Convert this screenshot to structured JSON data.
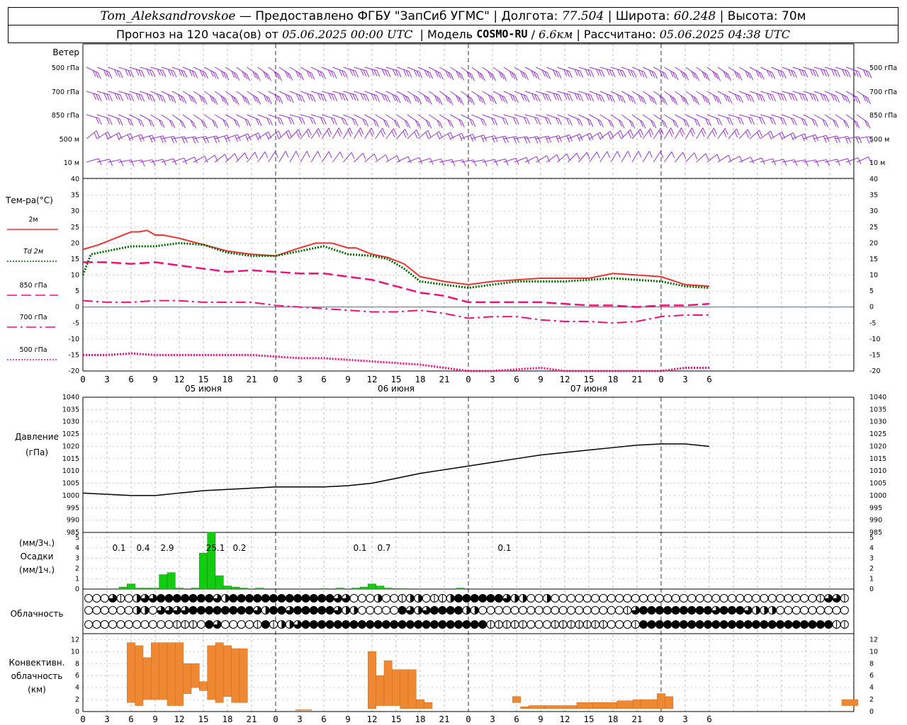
{
  "header": {
    "station": "Tom_Aleksandrovskoe",
    "provider": "Предоставлено ФГБУ \"ЗапСиб УГМС\"",
    "lon_label": "Долгота:",
    "lon": "77.504",
    "lat_label": "Широта:",
    "lat": "60.248",
    "alt_label": "Высота:",
    "alt": "70м",
    "forecast_prefix": "Прогноз на 120 часа(ов) от",
    "forecast_start": "05.06.2025 00:00 UTC",
    "model_label": "Модель",
    "model": "COSMO-RU",
    "resolution": "6.6км",
    "calc_label": "Рассчитано:",
    "calc_time": "05.06.2025 04:38 UTC"
  },
  "x_axis": {
    "hour_ticks": [
      "0",
      "3",
      "6",
      "9",
      "12",
      "15",
      "18",
      "21",
      "0",
      "3",
      "6",
      "9",
      "12",
      "15",
      "18",
      "21",
      "0",
      "3",
      "6",
      "9",
      "12",
      "15",
      "18",
      "21",
      "0",
      "3",
      "6"
    ],
    "dates": [
      "05 июня",
      "06 июня",
      "07 июня"
    ]
  },
  "wind_panel": {
    "title": "Ветер",
    "levels": [
      "500 гПа",
      "700 гПа",
      "850 гПа",
      "500 м",
      "10  м"
    ],
    "color": "#9933cc"
  },
  "temperature_panel": {
    "title": "Тем-ра(°С)",
    "legend": [
      {
        "label": "2м",
        "color": "#ee3333",
        "dash": "solid"
      },
      {
        "label": "Td  2м",
        "color": "#006600",
        "dash": "dotted"
      },
      {
        "label": "850 гПа",
        "color": "#ee1177",
        "dash": "long-dash"
      },
      {
        "label": "700 гПа",
        "color": "#ee1177",
        "dash": "dash-dot"
      },
      {
        "label": "500 гПа",
        "color": "#ee1177",
        "dash": "dotted"
      }
    ],
    "y_ticks": [
      "40",
      "35",
      "30",
      "25",
      "20",
      "15",
      "10",
      "5",
      "0",
      "-5",
      "-10",
      "-15",
      "-20"
    ]
  },
  "pressure_panel": {
    "title": "Давление",
    "unit": "(гПа)",
    "y_ticks": [
      "1040",
      "1035",
      "1030",
      "1025",
      "1020",
      "1015",
      "1010",
      "1005",
      "1000",
      "995",
      "990",
      "985"
    ]
  },
  "precip_panel": {
    "unit1": "(мм/3ч.)",
    "title": "Осадки",
    "unit2": "(мм/1ч.)",
    "y_ticks": [
      "5",
      "4",
      "3",
      "2",
      "1",
      "0"
    ],
    "totals": [
      {
        "hour": 6,
        "text": "0.1"
      },
      {
        "hour": 9,
        "text": "0.4"
      },
      {
        "hour": 12,
        "text": "2.9"
      },
      {
        "hour": 18,
        "text": "25.1"
      },
      {
        "hour": 21,
        "text": "0.2"
      },
      {
        "hour": 36,
        "text": "0.1"
      },
      {
        "hour": 39,
        "text": "0.7"
      },
      {
        "hour": 54,
        "text": "0.1"
      }
    ],
    "color": "#11cc11"
  },
  "cloud_panel": {
    "title": "Облачность"
  },
  "convective_panel": {
    "title_1": "Конвективн.",
    "title_2": "облачность",
    "unit": "(км)",
    "y_ticks": [
      "12",
      "10",
      "8",
      "6",
      "4",
      "2",
      "0"
    ],
    "color": "#ee8833"
  },
  "chart_data": [
    {
      "type": "line",
      "title": "Тем-ра(°С)",
      "x_unit": "hours from 05.06.2025 00:00 UTC",
      "ylim": [
        -20,
        40
      ],
      "series": [
        {
          "name": "2м",
          "x": [
            0,
            2,
            4,
            6,
            7,
            8,
            9,
            10,
            12,
            15,
            18,
            21,
            24,
            27,
            29,
            31,
            33,
            34,
            36,
            38,
            40,
            42,
            45,
            48,
            51,
            54,
            57,
            60,
            63,
            66,
            69,
            72,
            75,
            78
          ],
          "values": [
            18,
            19.5,
            21.5,
            23.5,
            23.5,
            24,
            22.5,
            22.5,
            21.5,
            19.5,
            17.5,
            16.5,
            16,
            18.5,
            20,
            20,
            18.5,
            18.5,
            16.5,
            15.5,
            13.5,
            9.5,
            8,
            7,
            8,
            8.5,
            9,
            9,
            9,
            10.5,
            10,
            9.5,
            7,
            6.5
          ]
        },
        {
          "name": "Td  2м",
          "x": [
            0,
            1,
            3,
            6,
            9,
            12,
            15,
            18,
            21,
            24,
            27,
            30,
            33,
            36,
            38,
            40,
            42,
            45,
            48,
            51,
            54,
            57,
            60,
            63,
            66,
            69,
            72,
            75,
            78
          ],
          "values": [
            10,
            16.5,
            17.5,
            19,
            19,
            20,
            19.5,
            17,
            16,
            16,
            17.5,
            19,
            16.5,
            16,
            15,
            12,
            8,
            7,
            6,
            7,
            8,
            8,
            8,
            8.5,
            9,
            8.5,
            8,
            6.5,
            6
          ]
        },
        {
          "name": "850 гПа",
          "x": [
            0,
            3,
            6,
            9,
            12,
            15,
            18,
            21,
            24,
            27,
            30,
            33,
            36,
            39,
            42,
            45,
            48,
            51,
            54,
            57,
            60,
            63,
            66,
            69,
            72,
            75,
            78
          ],
          "values": [
            14,
            14,
            13.5,
            14,
            13,
            12,
            11,
            11.5,
            11,
            10.5,
            10.5,
            9.5,
            8.5,
            6.5,
            4.5,
            3.5,
            1.5,
            1.5,
            1.5,
            1.5,
            1,
            0.5,
            0.5,
            0,
            0.5,
            0.5,
            1
          ]
        },
        {
          "name": "700 гПа",
          "x": [
            0,
            3,
            6,
            9,
            12,
            15,
            18,
            21,
            24,
            27,
            30,
            33,
            36,
            39,
            42,
            45,
            48,
            51,
            54,
            57,
            60,
            63,
            66,
            69,
            72,
            75,
            78
          ],
          "values": [
            2,
            1.5,
            1.5,
            2,
            2,
            1.5,
            1.5,
            1.5,
            0.5,
            0,
            -0.5,
            -1,
            -1.5,
            -1.5,
            -1,
            -2,
            -3.5,
            -3,
            -3,
            -4,
            -4.5,
            -4.5,
            -5,
            -4.5,
            -3,
            -2.5,
            -2.5
          ]
        },
        {
          "name": "500 гПа",
          "x": [
            0,
            3,
            6,
            9,
            12,
            15,
            18,
            21,
            24,
            27,
            30,
            33,
            36,
            39,
            42,
            45,
            48,
            51,
            54,
            57,
            60,
            63,
            66,
            69,
            72,
            75,
            78
          ],
          "values": [
            -15,
            -15,
            -14.5,
            -15,
            -15,
            -15,
            -15,
            -15,
            -15.5,
            -16,
            -16,
            -16.5,
            -17,
            -17.5,
            -18,
            -19,
            -20,
            -20,
            -19.5,
            -19,
            -20,
            -21,
            -21,
            -20.5,
            -20,
            -19,
            -19
          ]
        }
      ]
    },
    {
      "type": "line",
      "title": "Давление",
      "ylabel": "(гПа)",
      "x_unit": "hours from 05.06.2025 00:00 UTC",
      "ylim": [
        985,
        1040
      ],
      "x": [
        0,
        3,
        6,
        9,
        12,
        15,
        18,
        21,
        24,
        27,
        30,
        33,
        36,
        39,
        42,
        45,
        48,
        51,
        54,
        57,
        60,
        63,
        66,
        69,
        72,
        75,
        78
      ],
      "values": [
        1001,
        1000.5,
        1000,
        1000,
        1001,
        1002,
        1002.5,
        1003,
        1003.5,
        1003.5,
        1003.5,
        1004,
        1005,
        1007,
        1009,
        1010.5,
        1012,
        1013.5,
        1015,
        1016.5,
        1017.5,
        1018.5,
        1019.5,
        1020.5,
        1021,
        1021,
        1020
      ]
    },
    {
      "type": "bar",
      "title": "Осадки",
      "ylabel": "(мм/1ч.)",
      "x_unit": "hours from 05.06.2025 00:00 UTC",
      "ylim": [
        0,
        5.5
      ],
      "x": [
        5,
        6,
        7,
        8,
        9,
        10,
        11,
        12,
        14,
        15,
        16,
        17,
        18,
        19,
        20,
        22,
        30,
        32,
        34,
        35,
        36,
        37,
        38,
        39,
        40,
        47
      ],
      "values": [
        0.2,
        0.5,
        0.1,
        0.1,
        0.1,
        1.4,
        1.6,
        0.1,
        0.1,
        3.5,
        5.8,
        1.3,
        0.3,
        0.2,
        0.1,
        0.1,
        0.05,
        0.1,
        0.1,
        0.2,
        0.5,
        0.3,
        0.1,
        0.05,
        0.05,
        0.1
      ]
    },
    {
      "type": "table",
      "title": "Облачность",
      "x_unit": "hours from 05.06.2025 00:00 UTC",
      "row_order": "top row = upper layer, bottom row = lower layer",
      "cloud_fraction_rows": [
        [
          0,
          0,
          0,
          3,
          1,
          0,
          2,
          3,
          3,
          4,
          4,
          4,
          4,
          4,
          4,
          4,
          3,
          2,
          4,
          4,
          4,
          4,
          4,
          4,
          4,
          4,
          4,
          4,
          4,
          4,
          4,
          3,
          3,
          0,
          0,
          0,
          2,
          0,
          0,
          1,
          2,
          2,
          0,
          1,
          1,
          2,
          4,
          4,
          4,
          4,
          4,
          4,
          3,
          2,
          2,
          0,
          0,
          2,
          0,
          0,
          0,
          0,
          0,
          0,
          0,
          0,
          0,
          0,
          0,
          0,
          0,
          0,
          0,
          0,
          0,
          0,
          0,
          0,
          0,
          0,
          0,
          0,
          0,
          0,
          0,
          0,
          0,
          0,
          0,
          0,
          0,
          1,
          3,
          3,
          1,
          3
        ],
        [
          0,
          0,
          0,
          0,
          0,
          0,
          2,
          2,
          0,
          3,
          3,
          3,
          3,
          4,
          4,
          4,
          4,
          4,
          4,
          4,
          4,
          3,
          2,
          4,
          4,
          3,
          4,
          4,
          4,
          4,
          4,
          3,
          2,
          2,
          0,
          0,
          0,
          0,
          0,
          4,
          3,
          2,
          3,
          4,
          4,
          4,
          4,
          2,
          2,
          0,
          0,
          0,
          0,
          0,
          0,
          0,
          0,
          0,
          0,
          0,
          0,
          0,
          0,
          0,
          0,
          0,
          0,
          1,
          3,
          4,
          4,
          4,
          4,
          4,
          4,
          4,
          4,
          4,
          3,
          4,
          4,
          4,
          3,
          2,
          2,
          2,
          0,
          0,
          0,
          0,
          0,
          0,
          0,
          0,
          0,
          0,
          1,
          3
        ],
        [
          0,
          0,
          0,
          0,
          0,
          0,
          0,
          0,
          0,
          0,
          0,
          1,
          1,
          1,
          0,
          4,
          3,
          0,
          0,
          0,
          0,
          1,
          4,
          1,
          2,
          2,
          3,
          4,
          4,
          4,
          4,
          4,
          4,
          4,
          4,
          4,
          4,
          4,
          4,
          4,
          4,
          4,
          4,
          4,
          4,
          4,
          4,
          4,
          4,
          4,
          1,
          1,
          1,
          1,
          1,
          0,
          0,
          0,
          1,
          1,
          1,
          1,
          1,
          1,
          1,
          0,
          0,
          0,
          1,
          4,
          4,
          4,
          4,
          4,
          4,
          4,
          4,
          4,
          4,
          4,
          4,
          4,
          4,
          4,
          4,
          4,
          4,
          4,
          4,
          4,
          4,
          4,
          4,
          1,
          1,
          1,
          0,
          0
        ]
      ]
    },
    {
      "type": "bar",
      "title": "Конвективн. облачность",
      "ylabel": "(км)",
      "x_unit": "hours from 05.06.2025 00:00 UTC",
      "ylim": [
        0,
        13
      ],
      "bars": [
        {
          "x": [
            5.5,
            6.5
          ],
          "base": 1.5,
          "top": 11.5
        },
        {
          "x": [
            6.5,
            7.5
          ],
          "base": 1.0,
          "top": 11.0
        },
        {
          "x": [
            7.5,
            8.5
          ],
          "base": 2.0,
          "top": 9.0
        },
        {
          "x": [
            8.5,
            9.5
          ],
          "base": 2.0,
          "top": 11.5
        },
        {
          "x": [
            9.5,
            10.5
          ],
          "base": 2.0,
          "top": 11.5
        },
        {
          "x": [
            10.5,
            11.5
          ],
          "base": 1.0,
          "top": 11.5
        },
        {
          "x": [
            11.5,
            12.5
          ],
          "base": 1.0,
          "top": 11.5
        },
        {
          "x": [
            12.5,
            13.5
          ],
          "base": 3.0,
          "top": 8.0
        },
        {
          "x": [
            13.5,
            14.5
          ],
          "base": 4.0,
          "top": 8.0
        },
        {
          "x": [
            14.5,
            15.5
          ],
          "base": 3.5,
          "top": 5.0
        },
        {
          "x": [
            15.5,
            16.5
          ],
          "base": 2.0,
          "top": 11.0
        },
        {
          "x": [
            16.5,
            17.5
          ],
          "base": 1.5,
          "top": 11.5
        },
        {
          "x": [
            17.5,
            18.5
          ],
          "base": 2.5,
          "top": 11.0
        },
        {
          "x": [
            18.5,
            19.5
          ],
          "base": 1.5,
          "top": 10.5
        },
        {
          "x": [
            19.5,
            20.5
          ],
          "base": 1.5,
          "top": 10.5
        },
        {
          "x": [
            26.5,
            28.5
          ],
          "base": 0.2,
          "top": 0.3
        },
        {
          "x": [
            35.5,
            36.5
          ],
          "base": 0.5,
          "top": 10.0
        },
        {
          "x": [
            36.5,
            37.5
          ],
          "base": 1.0,
          "top": 6.0
        },
        {
          "x": [
            37.5,
            38.5
          ],
          "base": 1.0,
          "top": 8.5
        },
        {
          "x": [
            38.5,
            39.5
          ],
          "base": 1.0,
          "top": 7.0
        },
        {
          "x": [
            39.5,
            40.5
          ],
          "base": 0.5,
          "top": 7.0
        },
        {
          "x": [
            40.5,
            41.5
          ],
          "base": 0.5,
          "top": 7.0
        },
        {
          "x": [
            41.5,
            42.5
          ],
          "base": 0.5,
          "top": 2.0
        },
        {
          "x": [
            42.5,
            43.5
          ],
          "base": 0.5,
          "top": 1.5
        },
        {
          "x": [
            53.5,
            54.5
          ],
          "base": 1.5,
          "top": 2.5
        },
        {
          "x": [
            54.5,
            55.5
          ],
          "base": 0.5,
          "top": 0.8
        },
        {
          "x": [
            55.5,
            57.5
          ],
          "base": 0.5,
          "top": 1.0
        },
        {
          "x": [
            57.5,
            61.5
          ],
          "base": 0.5,
          "top": 1.0
        },
        {
          "x": [
            61.5,
            63.5
          ],
          "base": 0.5,
          "top": 1.5
        },
        {
          "x": [
            63.5,
            66.5
          ],
          "base": 0.5,
          "top": 1.5
        },
        {
          "x": [
            66.5,
            68.5
          ],
          "base": 0.5,
          "top": 1.8
        },
        {
          "x": [
            68.5,
            69.5
          ],
          "base": 0.5,
          "top": 2.0
        },
        {
          "x": [
            69.5,
            71.5
          ],
          "base": 0.5,
          "top": 2.0
        },
        {
          "x": [
            71.5,
            72.5
          ],
          "base": 0.5,
          "top": 3.0
        },
        {
          "x": [
            72.5,
            73.5
          ],
          "base": 0.5,
          "top": 2.5
        },
        {
          "x": [
            94.5,
            96.5
          ],
          "base": 1.0,
          "top": 2.0
        }
      ]
    }
  ]
}
